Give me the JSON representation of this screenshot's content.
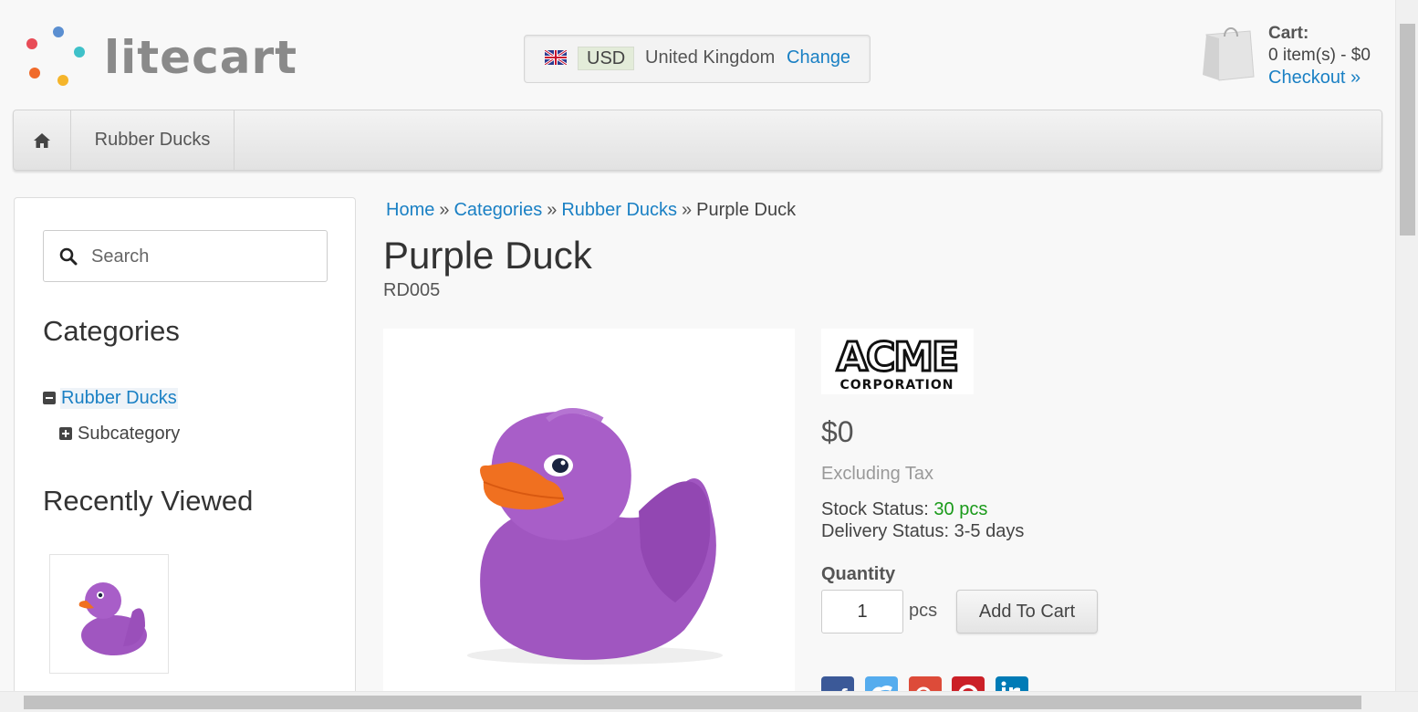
{
  "header": {
    "logo_text": "litecart",
    "currency": "USD",
    "country": "United Kingdom",
    "change_label": "Change",
    "cart": {
      "title": "Cart:",
      "summary": "0 item(s) - $0",
      "checkout_label": "Checkout »"
    }
  },
  "navbar": {
    "items": [
      {
        "label": "Rubber Ducks"
      }
    ]
  },
  "sidebar": {
    "search": {
      "placeholder": "Search",
      "value": ""
    },
    "categories_heading": "Categories",
    "categories": [
      {
        "label": "Rubber Ducks",
        "expanded": true
      },
      {
        "label": "Subcategory",
        "expanded": false
      }
    ],
    "recently_viewed_heading": "Recently Viewed"
  },
  "breadcrumb": {
    "items": [
      "Home",
      "Categories",
      "Rubber Ducks"
    ],
    "current": "Purple Duck",
    "separator": "»"
  },
  "product": {
    "title": "Purple Duck",
    "sku": "RD005",
    "manufacturer": {
      "line1": "ACME",
      "line2": "CORPORATION"
    },
    "price": "$0",
    "tax_note": "Excluding Tax",
    "stock_label": "Stock Status:",
    "stock_value": "30 pcs",
    "delivery_label": "Delivery Status:",
    "delivery_value": "3-5 days",
    "quantity_label": "Quantity",
    "quantity_value": "1",
    "quantity_unit": "pcs",
    "add_to_cart_label": "Add To Cart"
  },
  "social": [
    "facebook-icon",
    "twitter-icon",
    "google-plus-icon",
    "pinterest-icon",
    "linkedin-icon"
  ],
  "colors": {
    "link": "#1a80c4",
    "stock_ok": "#1a9a1a",
    "duck_body": "#a056c0",
    "duck_beak": "#f07020"
  }
}
